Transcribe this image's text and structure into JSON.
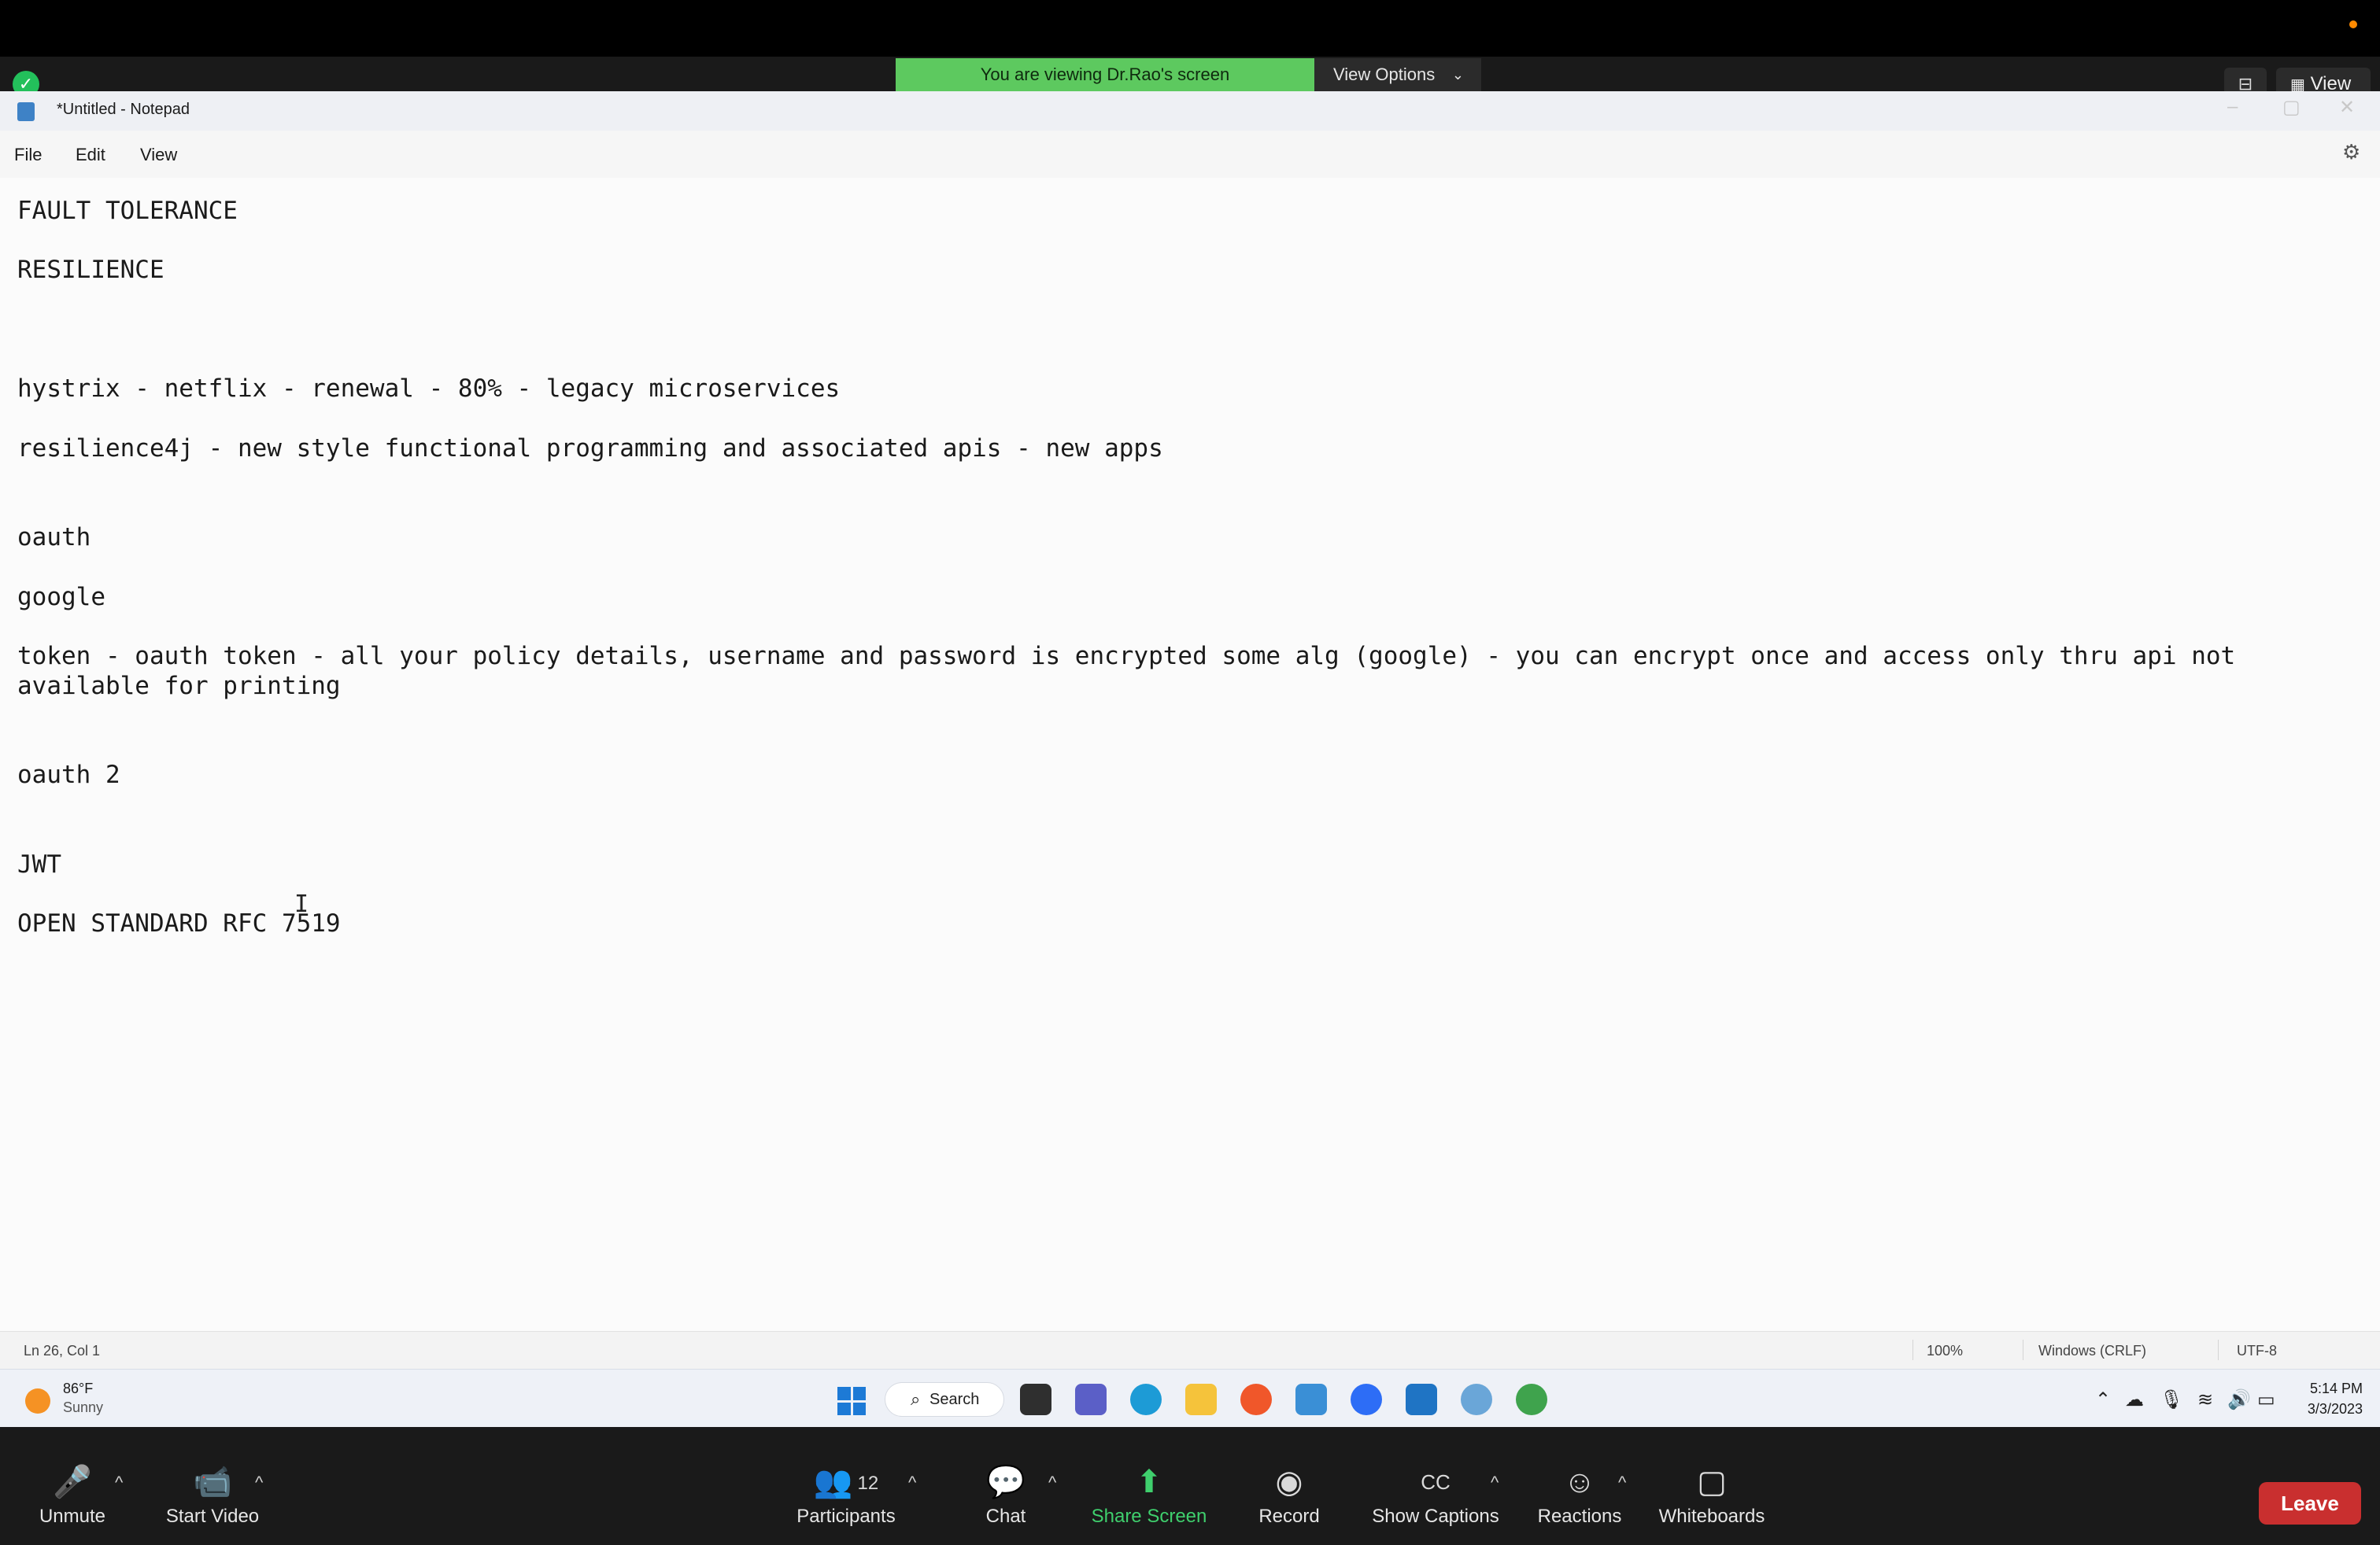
{
  "zoom_top": {
    "banner_text": "You are viewing Dr.Rao's screen",
    "view_options_label": "View Options",
    "view_label": "View"
  },
  "notepad": {
    "title": "*Untitled - Notepad",
    "menu": [
      "File",
      "Edit",
      "View"
    ],
    "lines": [
      "FAULT TOLERANCE",
      "RESILIENCE",
      "hystrix - netflix - renewal - 80% - legacy microservices",
      "resilience4j - new style functional programming and associated apis - new apps",
      "oauth",
      "google",
      "token - oauth token - all your policy details, username and password is encrypted some alg (google) - you can encrypt once and access only thru api not",
      "available for printing",
      "oauth 2",
      "JWT",
      "OPEN STANDARD RFC 7519"
    ],
    "status": {
      "position": "Ln 26, Col 1",
      "zoom": "100%",
      "line_ending": "Windows (CRLF)",
      "encoding": "UTF-8"
    }
  },
  "taskbar": {
    "weather_temp": "86°F",
    "weather_desc": "Sunny",
    "search_label": "Search",
    "time": "5:14 PM",
    "date": "3/3/2023"
  },
  "zoom_bottom": {
    "unmute": "Unmute",
    "start_video": "Start Video",
    "participants": "Participants",
    "participants_count": "12",
    "chat": "Chat",
    "share_screen": "Share Screen",
    "record": "Record",
    "show_captions": "Show Captions",
    "reactions": "Reactions",
    "whiteboards": "Whiteboards",
    "leave": "Leave"
  }
}
